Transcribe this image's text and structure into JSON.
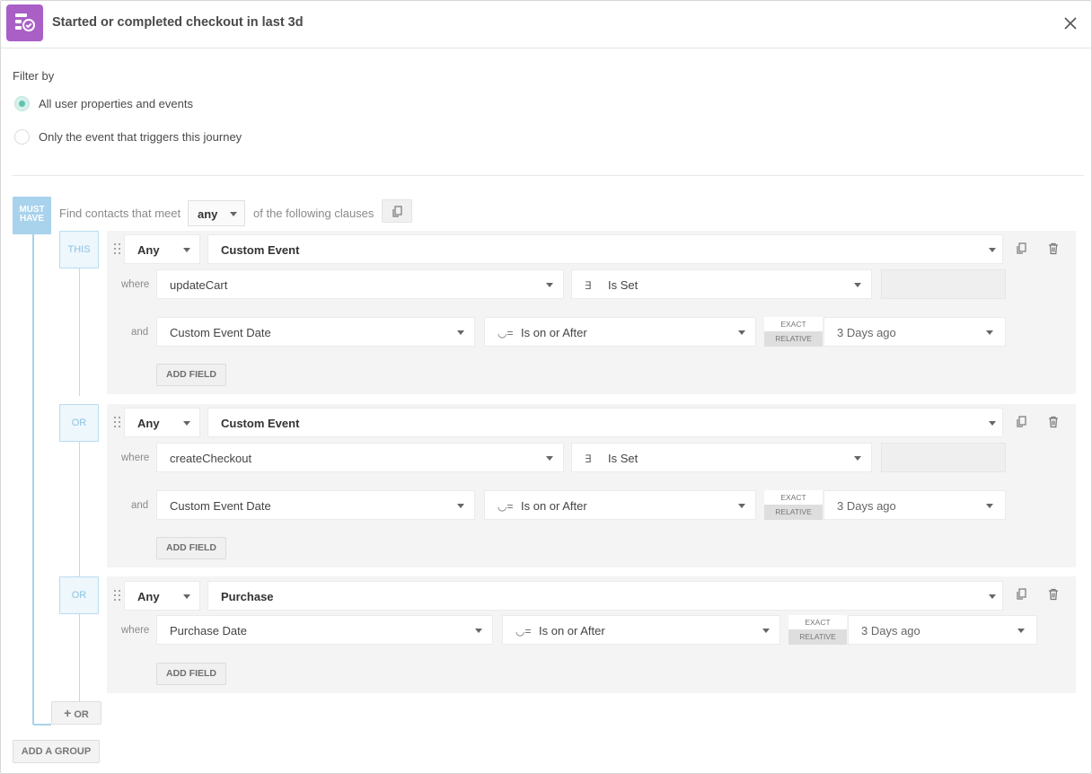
{
  "header": {
    "title": "Started or completed checkout in last 3d",
    "app_icon": "journey-filter-icon",
    "close_icon": "close-icon"
  },
  "filter": {
    "label": "Filter by",
    "options": [
      {
        "label": "All user properties and events",
        "selected": true
      },
      {
        "label": "Only the event that triggers this journey",
        "selected": false
      }
    ]
  },
  "group": {
    "badge_line1": "MUST",
    "badge_line2": "HAVE",
    "find_prefix": "Find contacts that meet",
    "match_value": "any",
    "find_suffix": "of the following clauses"
  },
  "clauses": [
    {
      "tag": "THIS",
      "quantifier": "Any",
      "event_type": "Custom Event",
      "where_label": "where",
      "where_field": "updateCart",
      "where_op_symbol": "∃",
      "where_op": "Is Set",
      "and_label": "and",
      "and_field": "Custom Event Date",
      "and_op_symbol": "◡=",
      "and_op": "Is on or After",
      "toggle_exact": "EXACT",
      "toggle_relative": "RELATIVE",
      "and_value": "3 Days ago",
      "add_field": "ADD FIELD"
    },
    {
      "tag": "OR",
      "quantifier": "Any",
      "event_type": "Custom Event",
      "where_label": "where",
      "where_field": "createCheckout",
      "where_op_symbol": "∃",
      "where_op": "Is Set",
      "and_label": "and",
      "and_field": "Custom Event Date",
      "and_op_symbol": "◡=",
      "and_op": "Is on or After",
      "toggle_exact": "EXACT",
      "toggle_relative": "RELATIVE",
      "and_value": "3 Days ago",
      "add_field": "ADD FIELD"
    },
    {
      "tag": "OR",
      "quantifier": "Any",
      "event_type": "Purchase",
      "where_label": "where",
      "where_field": "Purchase Date",
      "where_op_symbol": "◡=",
      "where_op": "Is on or After",
      "toggle_exact": "EXACT",
      "toggle_relative": "RELATIVE",
      "where_value": "3 Days ago",
      "add_field": "ADD FIELD"
    }
  ],
  "footer": {
    "or_button": "OR",
    "add_group": "ADD A GROUP"
  },
  "colors": {
    "accent_purple": "#a95fc6",
    "radio_teal": "#5fc4ad",
    "group_blue": "#a9d2ec"
  }
}
